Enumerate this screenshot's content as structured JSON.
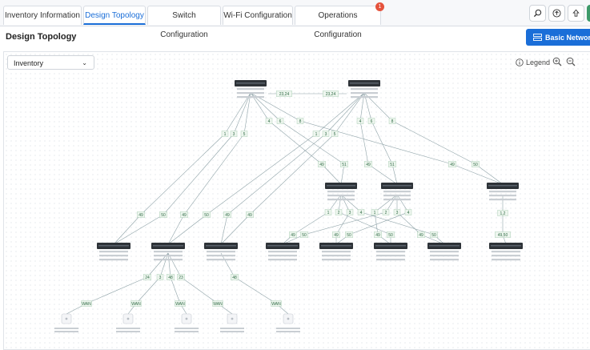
{
  "tabs": [
    {
      "label": "Inventory Information"
    },
    {
      "label": "Design Topology"
    },
    {
      "label": "Switch Configuration"
    },
    {
      "label": "Wi-Fi Configuration"
    },
    {
      "label": "Operations Configuration"
    }
  ],
  "tab_badge": "1",
  "page": {
    "title": "Design Topology",
    "primary_button": "Basic Network"
  },
  "toolbar": {
    "inventory_select": "Inventory",
    "legend_label": "Legend"
  },
  "icons": [
    "search-icon",
    "upload-icon",
    "share-icon",
    "zoom-in-icon",
    "zoom-out-icon",
    "info-icon"
  ],
  "colors": {
    "accent": "#1a6ed8",
    "badge": "#e5533d",
    "link": "#8fa3a8",
    "port_label": "#2f6b44"
  },
  "topology": {
    "port_labels": {
      "core_link_a": "23,24",
      "core_link_b": "23,24",
      "c1_ports": [
        "1",
        "3",
        "5",
        "4",
        "6",
        "8"
      ],
      "c2_ports": [
        "1",
        "3",
        "5",
        "4",
        "6",
        "8"
      ],
      "agg_up": [
        "49",
        "51",
        "49",
        "51",
        "49",
        "50"
      ],
      "acc_up": [
        "49",
        "50",
        "49",
        "50",
        "49",
        "49"
      ],
      "acc_down": [
        "1",
        "2",
        "3",
        "4",
        "1",
        "2",
        "3",
        "4"
      ],
      "mid_sw": [
        "49",
        "50",
        "49",
        "50",
        "49",
        "50",
        "49",
        "50"
      ],
      "right_acc": [
        "1,2",
        "49,50"
      ],
      "edge_ports": [
        "24",
        "3",
        "48",
        "23",
        "48"
      ],
      "ap_links": [
        "WAN",
        "WAN",
        "WAN",
        "WAN",
        "WAN"
      ]
    }
  }
}
